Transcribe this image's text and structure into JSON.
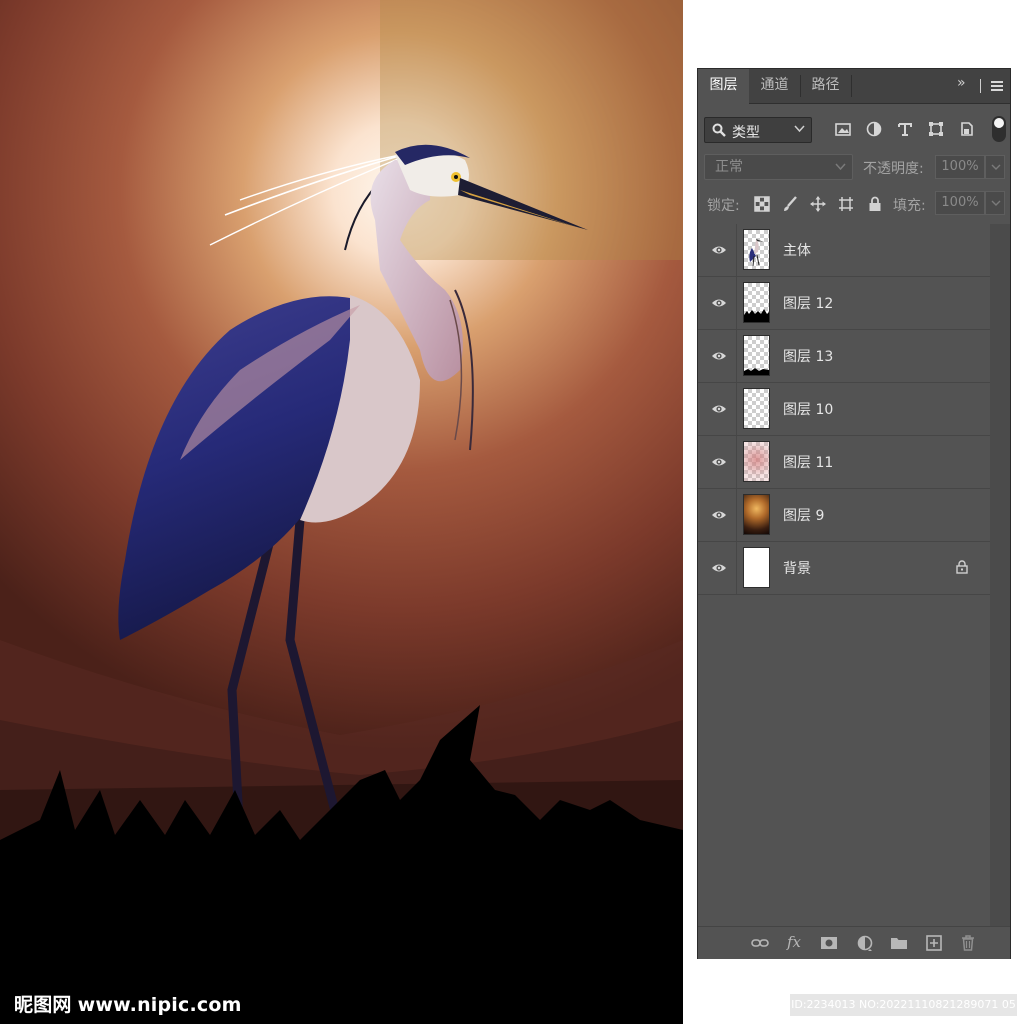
{
  "artwork": {
    "watermark_cn": "昵图网",
    "watermark_url": "www.nipic.com"
  },
  "panel": {
    "tabs": [
      {
        "label": "图层",
        "active": true
      },
      {
        "label": "通道",
        "active": false
      },
      {
        "label": "路径",
        "active": false
      }
    ],
    "collapse_glyph": "»",
    "filter": {
      "label": "类型",
      "icons": [
        "image-filter-icon",
        "adjustment-filter-icon",
        "type-filter-icon",
        "shape-filter-icon",
        "smart-object-filter-icon"
      ]
    },
    "blend_mode": "正常",
    "opacity_label": "不透明度:",
    "opacity_value": "100%",
    "lock_label": "锁定:",
    "fill_label": "填充:",
    "fill_value": "100%",
    "layers": [
      {
        "name": "主体",
        "thumb": "bird",
        "visible": true,
        "locked": false
      },
      {
        "name": "图层 12",
        "thumb": "grass-black",
        "visible": true,
        "locked": false
      },
      {
        "name": "图层 13",
        "thumb": "grass-black-small",
        "visible": true,
        "locked": false
      },
      {
        "name": "图层 10",
        "thumb": "transparent",
        "visible": true,
        "locked": false
      },
      {
        "name": "图层 11",
        "thumb": "pink",
        "visible": true,
        "locked": false
      },
      {
        "name": "图层 9",
        "thumb": "glow",
        "visible": true,
        "locked": false
      },
      {
        "name": "背景",
        "thumb": "white",
        "visible": true,
        "locked": true
      }
    ],
    "footer_icons": [
      "link-layers-icon",
      "fx-icon",
      "add-mask-icon",
      "adjustment-layer-icon",
      "new-group-icon",
      "new-layer-icon",
      "delete-layer-icon"
    ],
    "fx_label": "fx"
  },
  "id_stamp": "ID:2234013 NO:20221110821289071 05"
}
